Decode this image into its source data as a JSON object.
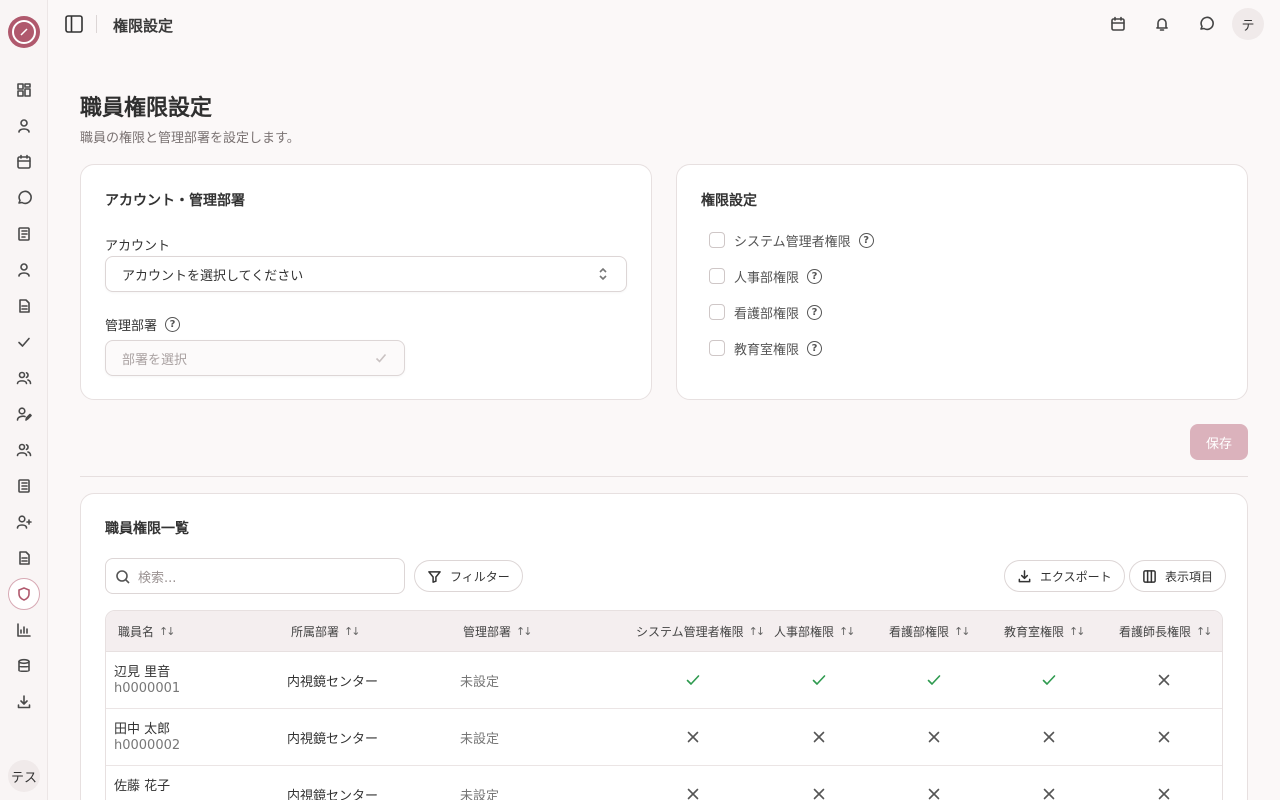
{
  "header": {
    "title": "権限設定"
  },
  "user": {
    "avatar_text": "テ",
    "sidebar_avatar_text": "テス"
  },
  "page": {
    "title": "職員権限設定",
    "subtitle": "職員の権限と管理部署を設定します。"
  },
  "account_card": {
    "title": "アカウント・管理部署",
    "account_label": "アカウント",
    "account_placeholder": "アカウントを選択してください",
    "dept_label": "管理部署",
    "dept_placeholder": "部署を選択"
  },
  "perm_card": {
    "title": "権限設定",
    "items": [
      "システム管理者権限",
      "人事部権限",
      "看護部権限",
      "教育室権限"
    ]
  },
  "save_label": "保存",
  "list": {
    "title": "職員権限一覧",
    "search_placeholder": "検索...",
    "filter_label": "フィルター",
    "export_label": "エクスポート",
    "columns_label": "表示項目",
    "headers": [
      "職員名",
      "所属部署",
      "管理部署",
      "システム管理者権限",
      "人事部権限",
      "看護部権限",
      "教育室権限",
      "看護師長権限"
    ],
    "sort_glyph": "↑↓",
    "rows": [
      {
        "name": "辺見 里音",
        "id": "h0000001",
        "dept": "内視鏡センター",
        "manage": "未設定",
        "perms": [
          true,
          true,
          true,
          true,
          false
        ]
      },
      {
        "name": "田中 太郎",
        "id": "h0000002",
        "dept": "内視鏡センター",
        "manage": "未設定",
        "perms": [
          false,
          false,
          false,
          false,
          false
        ]
      },
      {
        "name": "佐藤 花子",
        "id": "",
        "dept": "内視鏡センター",
        "manage": "未設定",
        "perms": [
          false,
          false,
          false,
          false,
          false
        ]
      }
    ]
  },
  "colors": {
    "accent": "#b0596d",
    "check": "#2e9a4f",
    "save_disabled": "#dbb2bc"
  }
}
